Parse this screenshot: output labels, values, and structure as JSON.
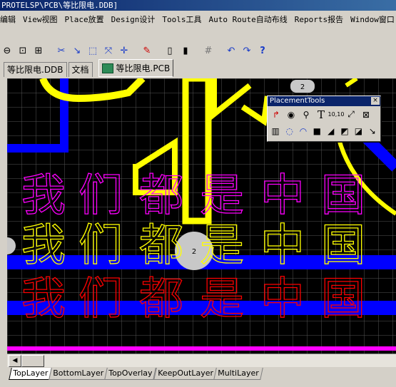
{
  "window": {
    "title": "PROTELSP\\PCB\\等比限电.DDB]"
  },
  "menu": [
    {
      "label": "编辑"
    },
    {
      "label": "View视图"
    },
    {
      "label": "Place放置"
    },
    {
      "label": "Design设计"
    },
    {
      "label": "Tools工具"
    },
    {
      "label": "Auto Route自动布线"
    },
    {
      "label": "Reports报告"
    },
    {
      "label": "Window窗口"
    }
  ],
  "toolbar": {
    "icons": [
      "zoom-out-icon",
      "zoom-area-icon",
      "zoom-fit-icon",
      "cut-icon",
      "select-icon",
      "marquee-icon",
      "move-icon",
      "cross-icon",
      "pen-icon",
      "library-icon",
      "browse-icon",
      "grid-icon",
      "undo-icon",
      "redo-icon",
      "help-icon"
    ],
    "help_glyph": "?"
  },
  "doc_tabs": [
    {
      "label": "等比限电.DDB"
    },
    {
      "label": "文档"
    },
    {
      "label": "等比限电.PCB"
    }
  ],
  "palette": {
    "title": "PlacementTools",
    "close": "×",
    "text_tool_glyph": "T",
    "dimension_glyph": "10,10"
  },
  "pcb": {
    "pad_labels": [
      "2",
      "2"
    ],
    "silk_text": [
      "我",
      "们",
      "都",
      "是",
      "中",
      "国"
    ],
    "colors": {
      "top": "#ff0000",
      "bottom": "#0000ff",
      "overlay": "#ffff00",
      "keepout": "#ff00ff",
      "grid": "#555555"
    }
  },
  "layer_tabs": [
    {
      "label": "TopLayer",
      "active": true
    },
    {
      "label": "BottomLayer"
    },
    {
      "label": "TopOverlay"
    },
    {
      "label": "KeepOutLayer"
    },
    {
      "label": "MultiLayer"
    }
  ]
}
